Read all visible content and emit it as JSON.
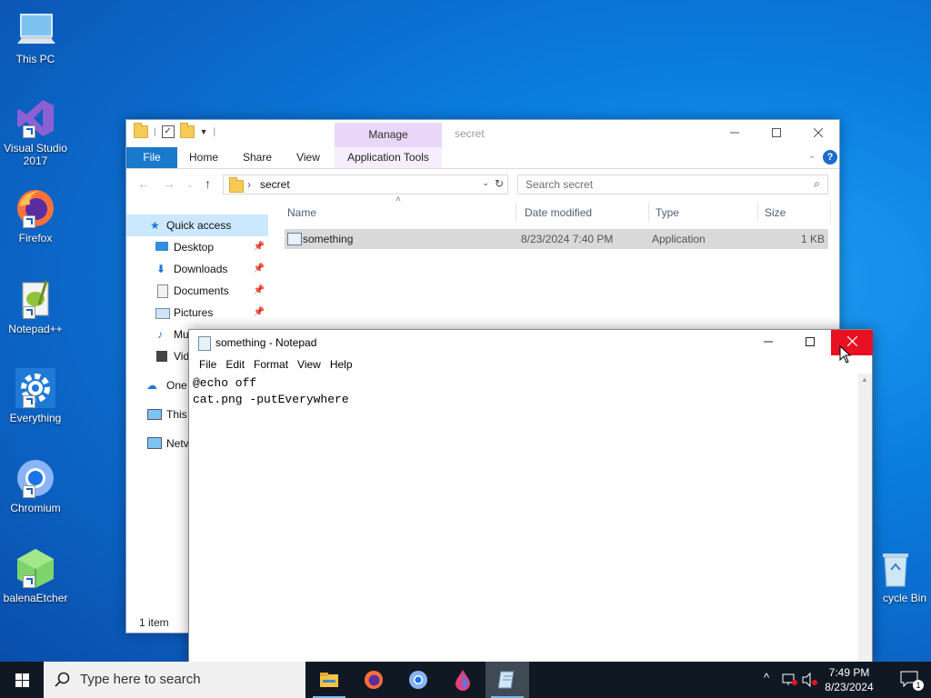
{
  "desktop": {
    "icons": [
      {
        "label": "This PC"
      },
      {
        "label": "Visual Studio 2017"
      },
      {
        "label": "Firefox"
      },
      {
        "label": "Notepad++"
      },
      {
        "label": "Everything"
      },
      {
        "label": "Chromium"
      },
      {
        "label": "balenaEtcher"
      },
      {
        "label": "cycle Bin"
      }
    ]
  },
  "explorer": {
    "title": "secret",
    "manage_tab": "Manage",
    "ribbon_tabs": [
      "File",
      "Home",
      "Share",
      "View",
      "Application Tools"
    ],
    "address": "secret",
    "search_placeholder": "Search secret",
    "nav": [
      {
        "label": "Quick access"
      },
      {
        "label": "Desktop"
      },
      {
        "label": "Downloads"
      },
      {
        "label": "Documents"
      },
      {
        "label": "Pictures"
      },
      {
        "label": "Mu"
      },
      {
        "label": "Vid"
      },
      {
        "label": "One"
      },
      {
        "label": "This"
      },
      {
        "label": "Netv"
      }
    ],
    "columns": [
      "Name",
      "Date modified",
      "Type",
      "Size"
    ],
    "files": [
      {
        "name": "something",
        "date": "8/23/2024 7:40 PM",
        "type": "Application",
        "size": "1 KB"
      }
    ],
    "status": "1 item"
  },
  "notepad": {
    "title": "something - Notepad",
    "menu": [
      "File",
      "Edit",
      "Format",
      "View",
      "Help"
    ],
    "content": "@echo off\ncat.png -putEverywhere"
  },
  "taskbar": {
    "search_placeholder": "Type here to search",
    "time": "7:49 PM",
    "date": "8/23/2024",
    "notification_count": "1"
  }
}
